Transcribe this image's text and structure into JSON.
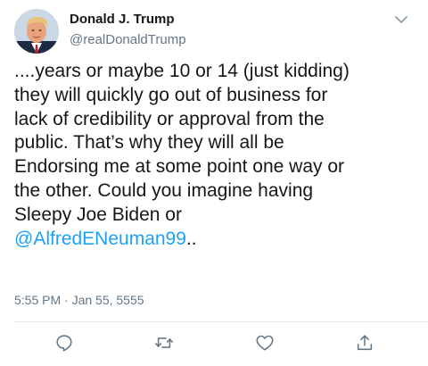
{
  "header": {
    "display_name": "Donald J. Trump",
    "handle": "@realDonaldTrump",
    "avatar_icon": "avatar-profile-photo",
    "menu_icon": "chevron-down-icon"
  },
  "tweet": {
    "lines": [
      "....years or maybe 10 or 14 (just kidding)",
      "they will quickly go out of business for",
      "lack of credibility or approval from the",
      "public. That’s why they will all be",
      "Endorsing me at some point one way or",
      "the other. Could you imagine having",
      "Sleepy Joe Biden or"
    ],
    "mention": "@AlfredENeuman99",
    "trailing": "..",
    "timestamp": "5:55 PM · Jan 55, 5555"
  },
  "actions": [
    {
      "name": "reply",
      "icon": "reply-icon"
    },
    {
      "name": "retweet",
      "icon": "retweet-icon"
    },
    {
      "name": "like",
      "icon": "heart-icon"
    },
    {
      "name": "share",
      "icon": "share-icon"
    }
  ],
  "colors": {
    "link": "#1da1f2",
    "secondary_text": "#657786",
    "primary_text": "#14171a",
    "divider": "#e1e8ed"
  }
}
